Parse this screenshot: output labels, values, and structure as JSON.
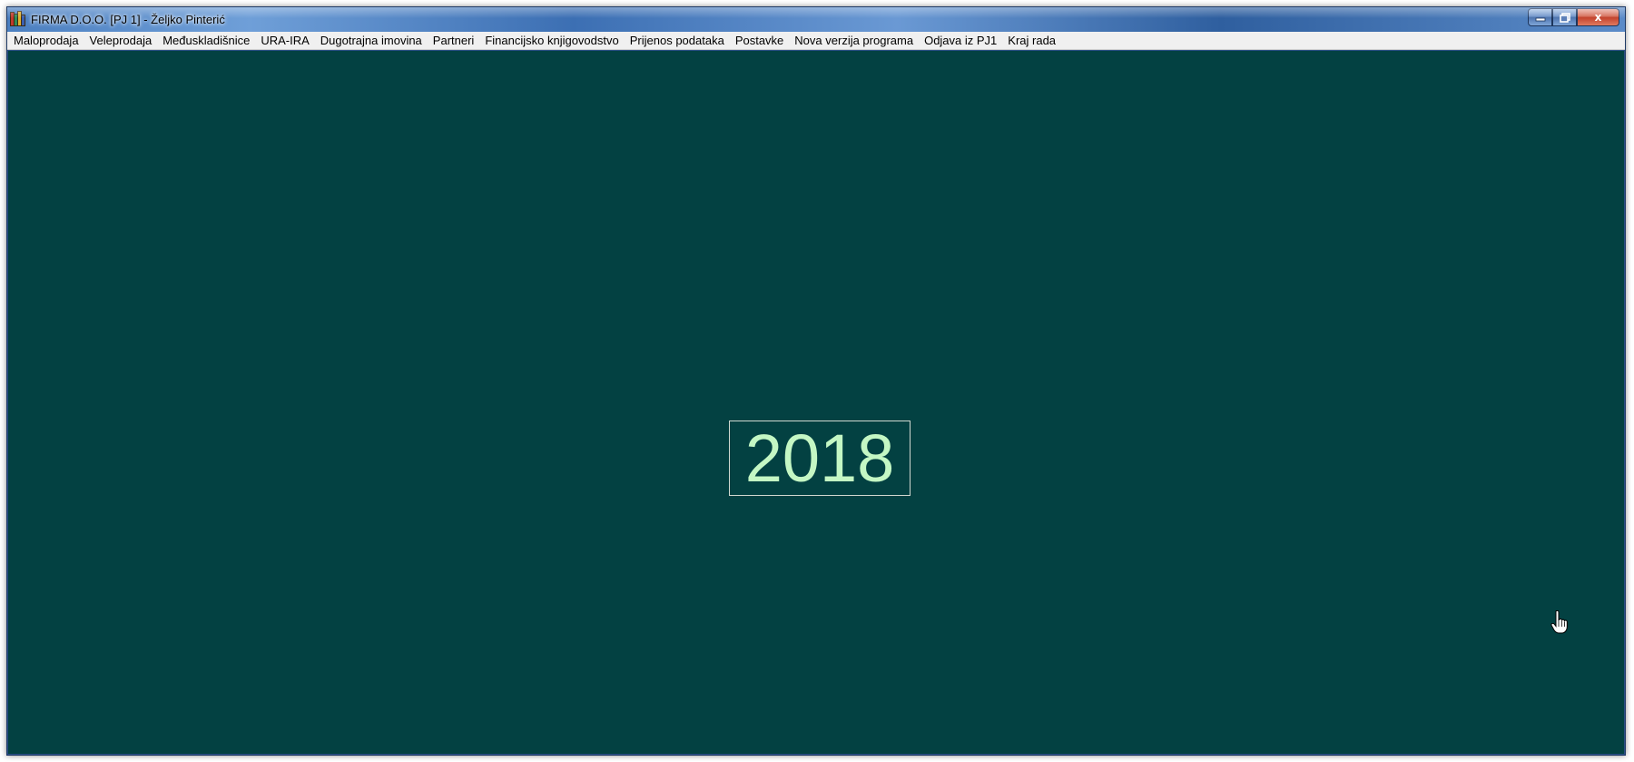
{
  "window": {
    "title": "FIRMA D.O.O. [PJ 1] - Željko Pinterić",
    "icon": "app-books-icon",
    "controls": {
      "minimize_icon": "minimize-icon",
      "maximize_icon": "restore-icon",
      "close_icon": "close-icon",
      "close_label": "x"
    }
  },
  "menu": {
    "items": [
      {
        "label": "Maloprodaja"
      },
      {
        "label": "Veleprodaja"
      },
      {
        "label": "Međuskladišnice"
      },
      {
        "label": "URA-IRA"
      },
      {
        "label": "Dugotrajna imovina"
      },
      {
        "label": "Partneri"
      },
      {
        "label": "Financijsko knjigovodstvo"
      },
      {
        "label": "Prijenos podataka"
      },
      {
        "label": "Postavke"
      },
      {
        "label": "Nova verzija programa"
      },
      {
        "label": "Odjava iz PJ1"
      },
      {
        "label": "Kraj rada"
      }
    ]
  },
  "main": {
    "year": "2018",
    "background_color": "#034142",
    "year_color": "#c4f7c4"
  },
  "cursor": {
    "icon": "hand-pointer-icon"
  }
}
